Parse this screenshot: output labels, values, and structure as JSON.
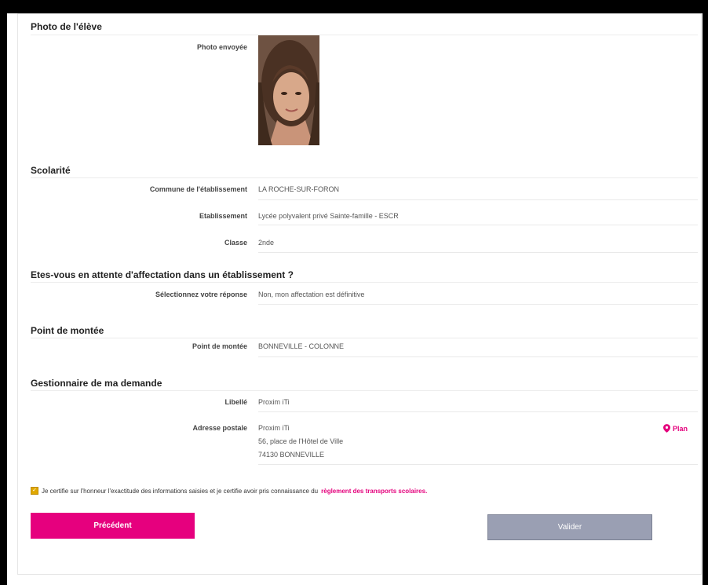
{
  "sections": {
    "photo": {
      "title": "Photo de l'élève",
      "label": "Photo envoyée"
    },
    "school": {
      "title": "Scolarité",
      "rows": [
        {
          "label": "Commune de l'établissement",
          "value": "LA ROCHE-SUR-FORON"
        },
        {
          "label": "Etablissement",
          "value": "Lycée polyvalent privé Sainte-famille - ESCR"
        },
        {
          "label": "Classe",
          "value": "2nde"
        }
      ]
    },
    "waiting": {
      "title": "Etes-vous en attente d'affectation dans un établissement ?",
      "rows": [
        {
          "label": "Sélectionnez votre réponse",
          "value": "Non, mon affectation est définitive"
        }
      ]
    },
    "boarding": {
      "title": "Point de montée",
      "rows": [
        {
          "label": "Point de montée",
          "value": "BONNEVILLE - COLONNE"
        }
      ]
    },
    "manager": {
      "title": "Gestionnaire de ma demande",
      "label_name": "Libellé",
      "name": "Proxim iTi",
      "label_address": "Adresse postale",
      "address_line1": "Proxim iTi",
      "address_line2": "56, place de l'Hôtel de Ville",
      "address_line3": "74130 BONNEVILLE",
      "map_link": "Plan"
    }
  },
  "certification": {
    "text": "Je certifie sur l'honneur l'exactitude des informations saisies et je certifie avoir pris connaissance du",
    "link": "règlement des transports scolaires."
  },
  "buttons": {
    "previous": "Précédent",
    "validate": "Valider"
  },
  "colors": {
    "accent": "#e6007e",
    "validate_bg": "#9a9fb3"
  }
}
